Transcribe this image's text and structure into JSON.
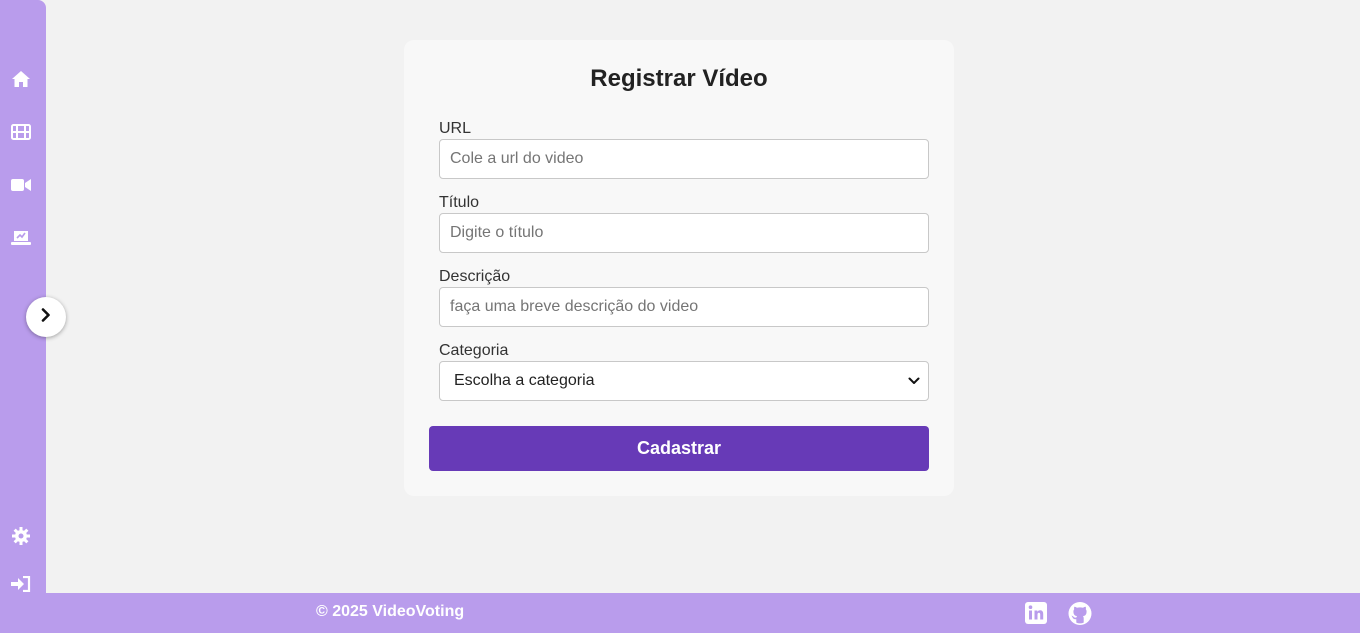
{
  "sidebar": {
    "icons": [
      "home-icon",
      "film-icon",
      "video-camera-icon",
      "laptop-chart-icon"
    ],
    "bottom_icons": [
      "gear-icon",
      "sign-in-icon"
    ],
    "toggle_icon": "chevron-right-icon",
    "background": "#b99cec"
  },
  "form": {
    "title": "Registrar Vídeo",
    "url_label": "URL",
    "url_placeholder": "Cole a url do video",
    "title_label": "Título",
    "title_placeholder": "Digite o título",
    "description_label": "Descrição",
    "description_placeholder": "faça uma breve descrição do video",
    "category_label": "Categoria",
    "category_selected": "Escolha a categoria",
    "submit_label": "Cadastrar",
    "accent": "#673ab7"
  },
  "footer": {
    "copyright": "© 2025 VideoVoting",
    "icons": [
      "linkedin-icon",
      "github-icon"
    ]
  }
}
